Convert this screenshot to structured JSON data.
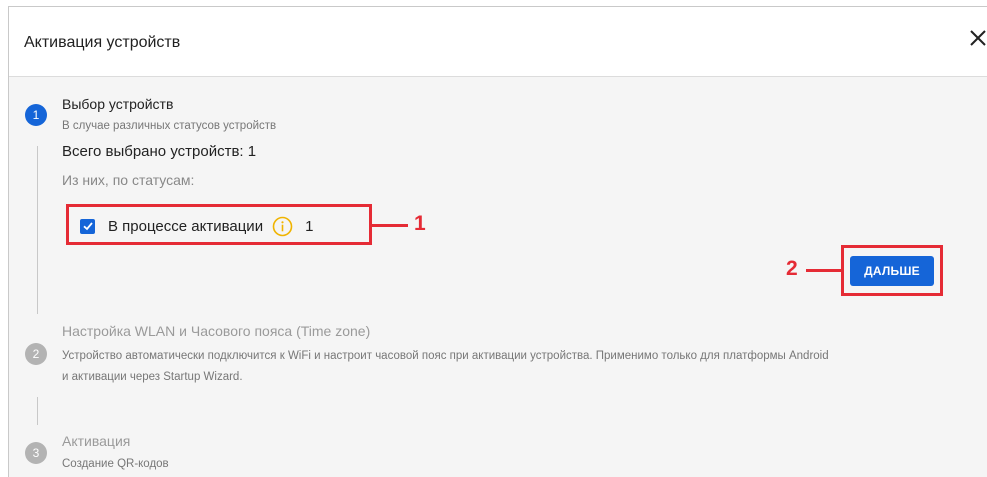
{
  "dialog": {
    "title": "Активация устройств",
    "close_icon": "close-icon"
  },
  "steps": [
    {
      "number": "1",
      "title": "Выбор устройств",
      "subtitle": "В случае различных статусов устройств",
      "state": "active"
    },
    {
      "number": "2",
      "title": "Настройка WLAN и Часового пояса (Time zone)",
      "subtitle_line1": "Устройство автоматически подключится к WiFi и настроит часовой пояс при активации устройства. Применимо только для платформы Android",
      "subtitle_line2": "и активации через Startup Wizard.",
      "state": "inactive"
    },
    {
      "number": "3",
      "title": "Активация",
      "subtitle": "Создание QR-кодов",
      "state": "inactive"
    }
  ],
  "selection": {
    "total_label": "Всего выбрано устройств: 1",
    "by_status_label": "Из них, по статусам:",
    "status_item": {
      "label": "В процессе активации",
      "count": "1",
      "checked": true,
      "info_icon": "info-icon"
    }
  },
  "next_button": {
    "label": "ДАЛЬШЕ"
  },
  "callouts": [
    {
      "number": "1"
    },
    {
      "number": "2"
    }
  ],
  "colors": {
    "accent": "#1565d8",
    "callout": "#e52b35",
    "info_icon": "#f0b400",
    "inactive": "#b3b3b3"
  }
}
